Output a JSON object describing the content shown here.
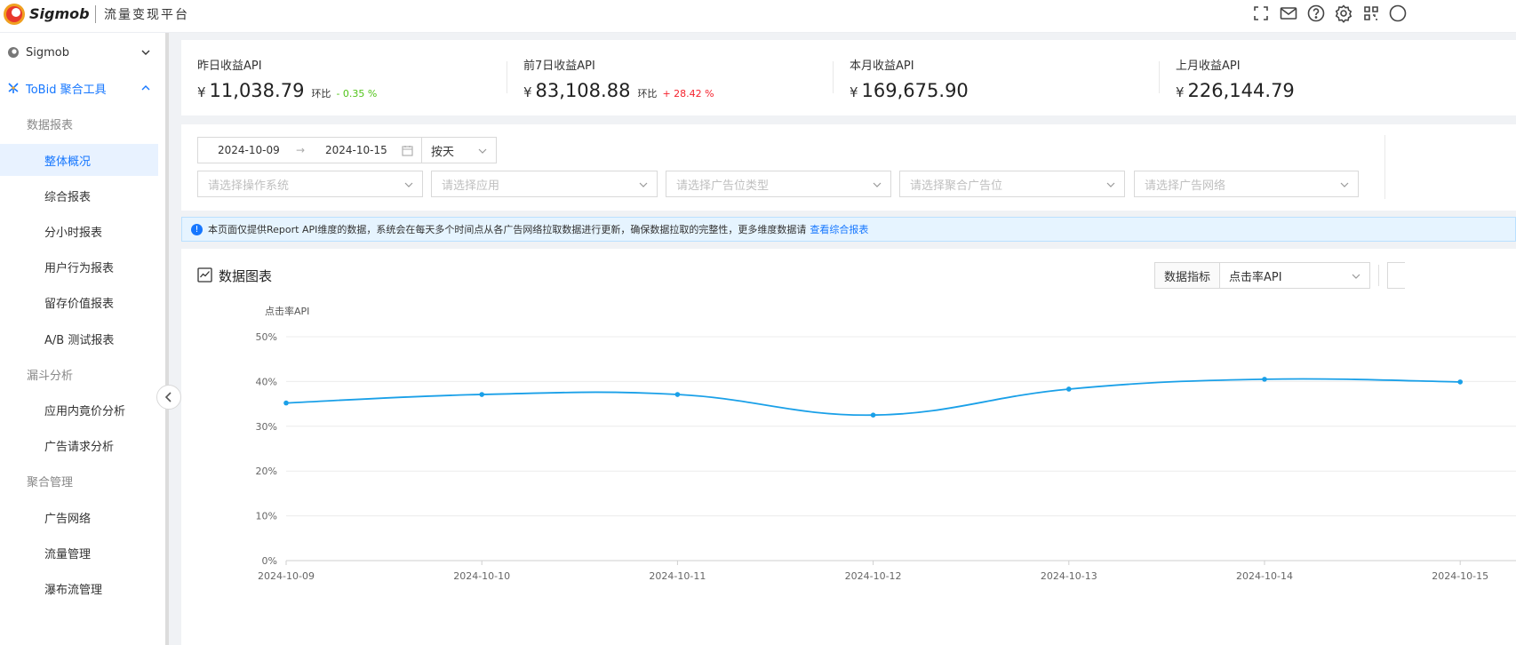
{
  "header": {
    "brand": "Sigmob",
    "platform": "流量变现平台",
    "icons": [
      "fullscreen-icon",
      "mail-icon",
      "help-icon",
      "settings-icon",
      "scan-icon",
      "more-icon"
    ]
  },
  "sidebar": {
    "items": [
      {
        "kind": "top",
        "label": "Sigmob",
        "icon": "sigmob-icon",
        "expanded": false,
        "active": false
      },
      {
        "kind": "top",
        "label": "ToBid 聚合工具",
        "icon": "tobid-icon",
        "expanded": true,
        "active": true
      },
      {
        "kind": "group",
        "label": "数据报表"
      },
      {
        "kind": "sub",
        "label": "整体概况",
        "active": true
      },
      {
        "kind": "sub",
        "label": "综合报表"
      },
      {
        "kind": "sub",
        "label": "分小时报表"
      },
      {
        "kind": "sub",
        "label": "用户行为报表"
      },
      {
        "kind": "sub",
        "label": "留存价值报表"
      },
      {
        "kind": "sub",
        "label": "A/B 测试报表"
      },
      {
        "kind": "group",
        "label": "漏斗分析"
      },
      {
        "kind": "sub",
        "label": "应用内竟价分析"
      },
      {
        "kind": "sub",
        "label": "广告请求分析"
      },
      {
        "kind": "group",
        "label": "聚合管理"
      },
      {
        "kind": "sub",
        "label": "广告网络"
      },
      {
        "kind": "sub",
        "label": "流量管理"
      },
      {
        "kind": "sub",
        "label": "瀑布流管理"
      }
    ]
  },
  "stats": [
    {
      "label": "昨日收益API",
      "currency": "¥",
      "value": "11,038.79",
      "hb_label": "环比",
      "delta": "- 0.35 %",
      "trend": "down"
    },
    {
      "label": "前7日收益API",
      "currency": "¥",
      "value": "83,108.88",
      "hb_label": "环比",
      "delta": "+ 28.42 %",
      "trend": "up"
    },
    {
      "label": "本月收益API",
      "currency": "¥",
      "value": "169,675.90"
    },
    {
      "label": "上月收益API",
      "currency": "¥",
      "value": "226,144.79"
    }
  ],
  "filters": {
    "date_start": "2024-10-09",
    "date_end": "2024-10-15",
    "date_arrow": "→",
    "granularity": "按天",
    "selects": [
      "请选择操作系统",
      "请选择应用",
      "请选择广告位类型",
      "请选择聚合广告位",
      "请选择广告网络"
    ]
  },
  "notice": {
    "text": "本页面仅提供Report API维度的数据，系统会在每天多个时间点从各广告网络拉取数据进行更新，确保数据拉取的完整性，更多维度数据请",
    "link": "查看综合报表"
  },
  "chart_panel": {
    "title": "数据图表",
    "metric_label": "数据指标",
    "metric_value": "点击率API"
  },
  "chart_data": {
    "type": "line",
    "ylabel": "点击率API",
    "x": [
      "2024-10-09",
      "2024-10-10",
      "2024-10-11",
      "2024-10-12",
      "2024-10-13",
      "2024-10-14",
      "2024-10-15"
    ],
    "series": [
      {
        "values": [
          35.2,
          37.1,
          37.1,
          32.5,
          38.3,
          40.5,
          39.9
        ]
      }
    ],
    "yticks": [
      "0%",
      "10%",
      "20%",
      "30%",
      "40%",
      "50%"
    ],
    "ylim": [
      0,
      50
    ],
    "grid": true,
    "color": "#1aa0e8"
  },
  "colors": {
    "accent": "#1677ff",
    "up": "#f5222d",
    "down": "#52c41a"
  }
}
